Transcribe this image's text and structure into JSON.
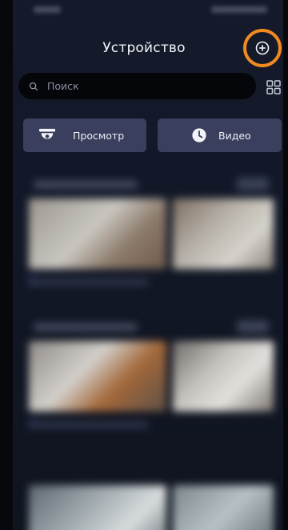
{
  "header": {
    "title": "Устройство"
  },
  "search": {
    "placeholder": "Поиск"
  },
  "actions": {
    "view_label": "Просмотр",
    "video_label": "Видео"
  },
  "icons": {
    "add": "plus-circle-icon",
    "search": "search-icon",
    "grid": "grid-icon",
    "view": "camera-icon",
    "video": "clock-icon"
  },
  "colors": {
    "accent_highlight": "#f28a1f",
    "button_bg": "#3a3f5e",
    "background": "#121827"
  }
}
